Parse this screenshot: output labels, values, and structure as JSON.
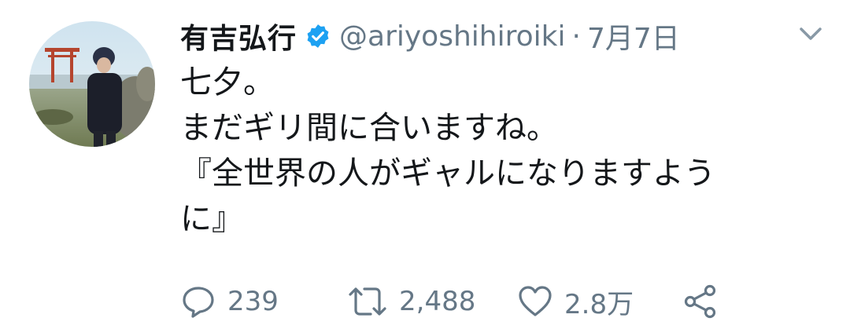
{
  "tweet": {
    "display_name": "有吉弘行",
    "handle": "@ariyoshihiroiki",
    "separator": "·",
    "date": "7月7日",
    "text_lines": [
      "七夕。",
      "まだギリ間に合いますね。",
      "『全世界の人がギャルになりますよう",
      "に』"
    ]
  },
  "actions": {
    "reply_count": "239",
    "retweet_count": "2,488",
    "like_count": "2.8万"
  },
  "icons": {
    "verified": "verified-badge-icon",
    "caret": "chevron-down-icon",
    "reply": "reply-icon",
    "retweet": "retweet-icon",
    "like": "heart-icon",
    "share": "share-icon"
  },
  "colors": {
    "text": "#14171a",
    "secondary": "#657786",
    "verified_blue": "#1da1f2"
  }
}
